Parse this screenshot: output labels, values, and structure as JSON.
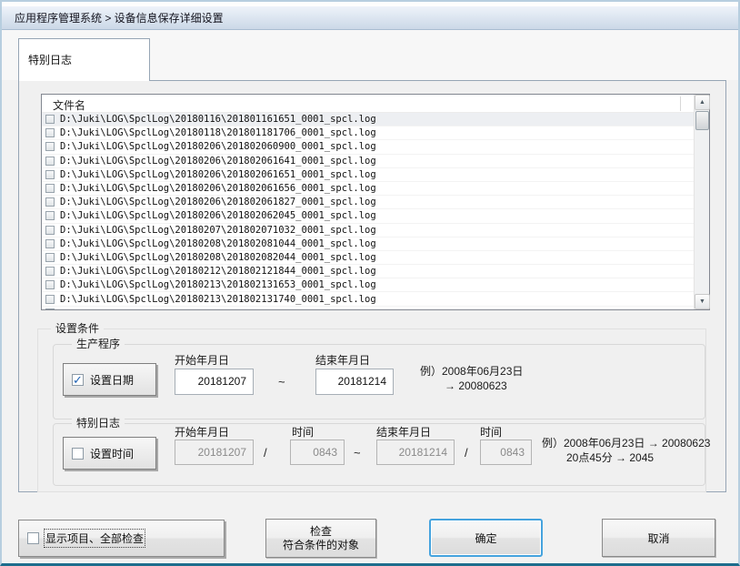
{
  "window": {
    "breadcrumb": "应用程序管理系统 > 设备信息保存详细设置",
    "tab": "特别日志"
  },
  "colors": {
    "band_top": "#eef3fa",
    "band_bottom": "#cbd8e7",
    "panel_bg": "#f0f0f0",
    "ok_button_border": "#45a3de",
    "check_mark": "#1f62b5",
    "window_bottom_edge": "#1d6d8c"
  },
  "file_list": {
    "header": "文件名",
    "files": [
      "D:\\Juki\\LOG\\SpclLog\\20180116\\201801161651_0001_spcl.log",
      "D:\\Juki\\LOG\\SpclLog\\20180118\\201801181706_0001_spcl.log",
      "D:\\Juki\\LOG\\SpclLog\\20180206\\201802060900_0001_spcl.log",
      "D:\\Juki\\LOG\\SpclLog\\20180206\\201802061641_0001_spcl.log",
      "D:\\Juki\\LOG\\SpclLog\\20180206\\201802061651_0001_spcl.log",
      "D:\\Juki\\LOG\\SpclLog\\20180206\\201802061656_0001_spcl.log",
      "D:\\Juki\\LOG\\SpclLog\\20180206\\201802061827_0001_spcl.log",
      "D:\\Juki\\LOG\\SpclLog\\20180206\\201802062045_0001_spcl.log",
      "D:\\Juki\\LOG\\SpclLog\\20180207\\201802071032_0001_spcl.log",
      "D:\\Juki\\LOG\\SpclLog\\20180208\\201802081044_0001_spcl.log",
      "D:\\Juki\\LOG\\SpclLog\\20180208\\201802082044_0001_spcl.log",
      "D:\\Juki\\LOG\\SpclLog\\20180212\\201802121844_0001_spcl.log",
      "D:\\Juki\\LOG\\SpclLog\\20180213\\201802131653_0001_spcl.log",
      "D:\\Juki\\LOG\\SpclLog\\20180213\\201802131740_0001_spcl.log"
    ]
  },
  "conditions": {
    "section_title": "设置条件",
    "production": {
      "group_title": "生产程序",
      "set_date_label": "设置日期",
      "set_date_checked": true,
      "start_label": "开始年月日",
      "start_value": "20181207",
      "range_separator": "~",
      "end_label": "结束年月日",
      "end_value": "20181214",
      "example_line1": "例）2008年06月23日",
      "example_line2": "→ 20080623"
    },
    "special_log": {
      "group_title": "特别日志",
      "set_time_label": "设置时间",
      "set_time_checked": false,
      "start_label": "开始年月日",
      "start_value": "20181207",
      "time_label_start": "时间",
      "start_time_value": "0843",
      "date_time_separator": "/",
      "range_separator": "~",
      "end_label": "结束年月日",
      "end_value": "20181214",
      "time_label_end": "时间",
      "end_time_value": "0843",
      "example_line1": "例）2008年06月23日 → 20080623",
      "example_line2": "20点45分 → 2045"
    }
  },
  "footer": {
    "show_all_label": "显示项目、全部检查",
    "show_all_checked": false,
    "check_matching_line1": "检查",
    "check_matching_line2": "符合条件的对象",
    "ok_label": "确定",
    "cancel_label": "取消"
  }
}
